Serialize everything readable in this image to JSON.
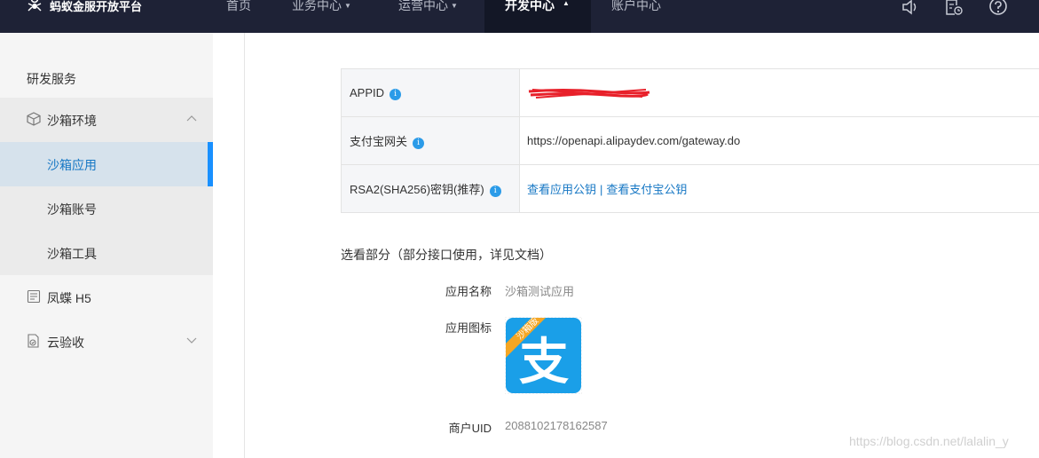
{
  "topbar": {
    "logo_text": "蚂蚁金服开放平台",
    "nav": {
      "home": "首页",
      "business": "业务中心",
      "operations": "运营中心",
      "developer": "开发中心",
      "account": "账户中心"
    },
    "icons": [
      "speaker-icon",
      "document-clock-icon",
      "help-icon"
    ]
  },
  "sidebar": {
    "title": "研发服务",
    "items": [
      {
        "label": "沙箱环境",
        "icon": "cube-icon",
        "expanded": true
      },
      {
        "label": "沙箱应用",
        "active": true
      },
      {
        "label": "沙箱账号"
      },
      {
        "label": "沙箱工具"
      },
      {
        "label": "凤蝶 H5",
        "icon": "butterfly-icon"
      },
      {
        "label": "云验收",
        "icon": "checklist-icon",
        "expanded": false
      }
    ]
  },
  "info_table": {
    "rows": [
      {
        "key": "APPID",
        "info_badge": "i",
        "value": ""
      },
      {
        "key": "支付宝网关",
        "info_badge": "i",
        "value": "https://openapi.alipaydev.com/gateway.do"
      },
      {
        "key": "RSA2(SHA256)密钥(推荐)",
        "info_badge": "i",
        "link1": "查看应用公钥",
        "separator": "|",
        "link2": "查看支付宝公钥"
      }
    ]
  },
  "details": {
    "section_title": "选看部分（部分接口使用，详见文档）",
    "app_name_label": "应用名称",
    "app_name_value": "沙箱测试应用",
    "app_icon_label": "应用图标",
    "app_icon_ribbon": "沙箱版",
    "app_icon_glyph": "支",
    "merchant_uid_label": "商户UID",
    "merchant_uid_value": "2088102178162587"
  },
  "watermark": "https://blog.csdn.net/lalalin_y",
  "colors": {
    "topbar_bg": "#1e2236",
    "active_nav_bg": "#131726",
    "sidebar_bg": "#f5f5f5",
    "active_item_bg": "#d6e2ec",
    "active_bar": "#1890ff",
    "link": "#1677c4",
    "alipay_blue": "#1a9fe8",
    "ribbon_orange": "#f5a623"
  }
}
